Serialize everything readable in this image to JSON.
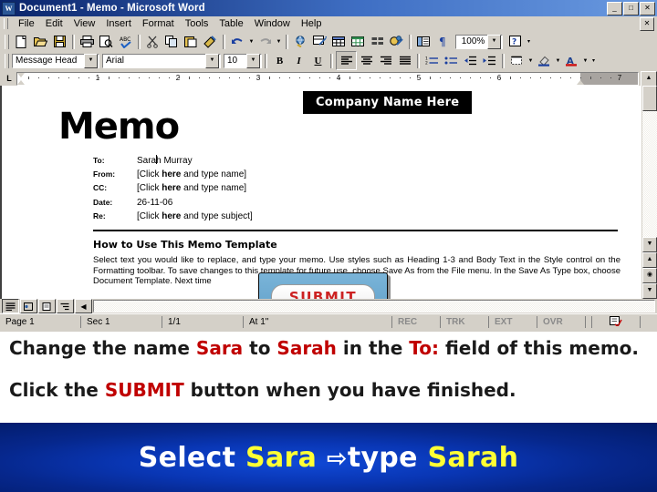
{
  "window": {
    "title": "Document1 - Memo - Microsoft Word",
    "icon": "word-document-icon",
    "minimize": "_",
    "maximize": "□",
    "close": "✕",
    "menu_close": "✕"
  },
  "menu": {
    "items": [
      "File",
      "Edit",
      "View",
      "Insert",
      "Format",
      "Tools",
      "Table",
      "Window",
      "Help"
    ]
  },
  "standard_toolbar": {
    "icons": [
      "new-document-icon",
      "open-folder-icon",
      "save-icon",
      "print-icon",
      "print-preview-icon",
      "spelling-check-icon",
      "cut-scissors-icon",
      "copy-icon",
      "paste-icon",
      "format-painter-icon",
      "undo-icon",
      "redo-icon",
      "insert-hyperlink-icon",
      "tables-and-borders-icon",
      "insert-table-icon",
      "insert-excel-worksheet-icon",
      "columns-icon",
      "drawing-icon",
      "document-map-icon",
      "show-formatting-marks-icon",
      "help-icon"
    ],
    "zoom_value": "100%"
  },
  "formatting_toolbar": {
    "style_value": "Message Head",
    "font_value": "Arial",
    "size_value": "10",
    "bold_label": "B",
    "italic_label": "I",
    "underline_label": "U",
    "icons": [
      "align-left-icon",
      "align-center-icon",
      "align-right-icon",
      "justify-icon",
      "numbered-list-icon",
      "bulleted-list-icon",
      "decrease-indent-icon",
      "increase-indent-icon",
      "borders-icon",
      "highlight-icon",
      "font-color-icon"
    ]
  },
  "ruler": {
    "numbers": [
      "1",
      "2",
      "3",
      "4",
      "5",
      "6",
      "7"
    ],
    "tab_stop_label": "L"
  },
  "document": {
    "heading": "Memo",
    "company_banner": "Company Name Here",
    "fields": [
      {
        "label": "To:",
        "value_before": "Sara",
        "value_after": "h Murray",
        "caret": true,
        "placeholder": false
      },
      {
        "label": "From:",
        "value_prefix": "[Click ",
        "value_bold": "here",
        "value_suffix": " and type name]",
        "placeholder": true
      },
      {
        "label": "CC:",
        "value_prefix": "[Click ",
        "value_bold": "here",
        "value_suffix": " and type name]",
        "placeholder": true
      },
      {
        "label": "Date:",
        "value_plain": "26-11-06",
        "placeholder": false
      },
      {
        "label": "Re:",
        "value_prefix": "[Click ",
        "value_bold": "here",
        "value_suffix": " and type subject]",
        "placeholder": true
      }
    ],
    "section_heading": "How to Use This Memo Template",
    "body_text": "Select text you would like to replace, and type your memo. Use styles such as Heading 1-3 and Body Text in the Style control on the Formatting toolbar. To save changes to this template for future use, choose Save As from the File menu. In the Save As Type box, choose Document Template. Next time",
    "submit_button_label": "SUBMIT"
  },
  "status_bar": {
    "page": "Page  1",
    "section": "Sec  1",
    "pages": "1/1",
    "at": "At  1\"",
    "indicators": [
      "REC",
      "TRK",
      "EXT",
      "OVR"
    ],
    "spell_icon": "spelling-status-icon"
  },
  "view_buttons": [
    "normal-view-icon",
    "web-layout-view-icon",
    "print-layout-view-icon",
    "outline-view-icon"
  ],
  "instructions": {
    "line1": {
      "part1": "Change the name ",
      "red1": "Sara",
      "part2": " to ",
      "red2": "Sarah",
      "part3": " in the ",
      "red3": "To:",
      "part4": " field of this memo."
    },
    "line2": {
      "part1": "Click the ",
      "red1": "SUBMIT",
      "part2": " button when you have finished."
    }
  },
  "footer": {
    "select_label": "Select ",
    "target_word": "Sara",
    "arrow": "⇨",
    "type_label": "type ",
    "replacement_word": "Sarah"
  },
  "colors": {
    "titlebar_blue": "#0a246a",
    "chrome_gray": "#d4d0c8",
    "accent_red": "#c00000",
    "footer_blue": "#0936b4",
    "footer_yellow": "#ffff33",
    "submit_red": "#cc2222"
  }
}
